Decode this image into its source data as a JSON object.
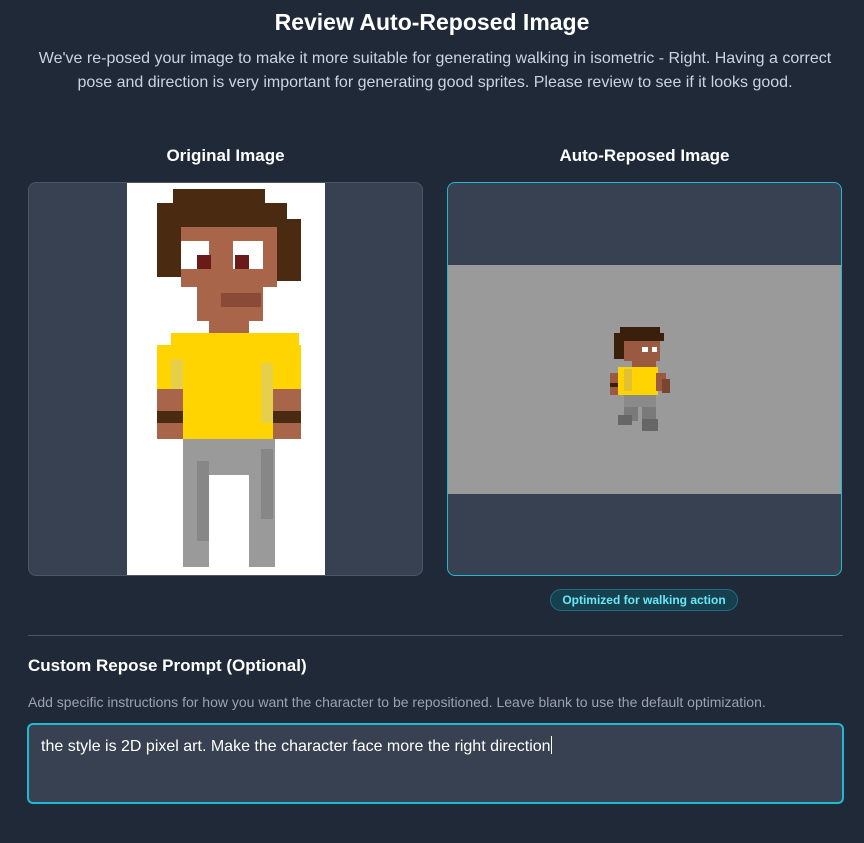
{
  "dialog": {
    "title": "Review Auto-Reposed Image",
    "description": "We've re-posed your image to make it more suitable for generating walking in isometric - Right. Having a correct pose and direction is very important for generating good sprites. Please review to see if it looks good."
  },
  "original": {
    "heading": "Original Image"
  },
  "reposed": {
    "heading": "Auto-Reposed Image",
    "badge": "Optimized for walking action"
  },
  "custom": {
    "heading": "Custom Repose Prompt (Optional)",
    "help": "Add specific instructions for how you want the character to be repositioned. Leave blank to use the default optimization.",
    "prompt_value": "the style is 2D pixel art. Make the character face more the right direction"
  },
  "colors": {
    "accent": "#22b8cf",
    "background": "#1f2937",
    "panel": "#374151"
  }
}
